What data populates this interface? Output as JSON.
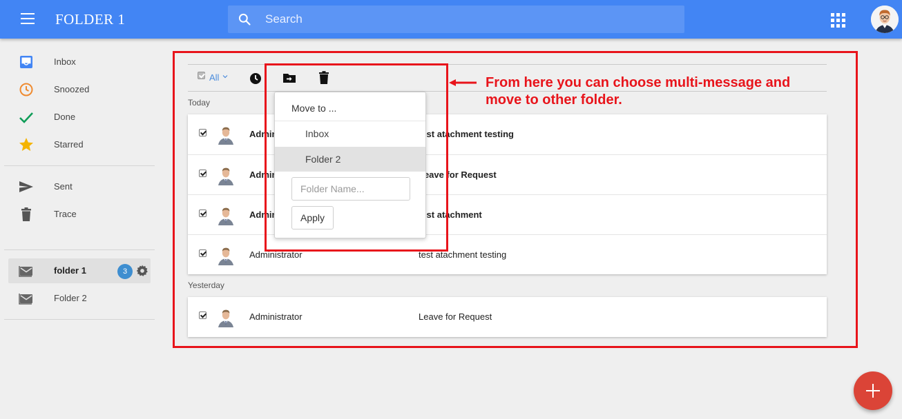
{
  "header": {
    "title": "FOLDER 1",
    "search_placeholder": "Search",
    "menu_icon": "menu-icon",
    "apps_icon": "apps-grid-icon"
  },
  "sidebar": {
    "items": [
      {
        "label": "Inbox",
        "icon": "inbox-icon",
        "color": "#4285f4"
      },
      {
        "label": "Snoozed",
        "icon": "clock-icon",
        "color": "#ef8a2f"
      },
      {
        "label": "Done",
        "icon": "check-icon",
        "color": "#0f9d58"
      },
      {
        "label": "Starred",
        "icon": "star-icon",
        "color": "#f4b400"
      },
      {
        "label": "Sent",
        "icon": "send-icon",
        "color": "#555555"
      },
      {
        "label": "Trace",
        "icon": "trash-icon",
        "color": "#555555"
      }
    ],
    "folders": [
      {
        "label": "folder 1",
        "badge": "3",
        "active": true,
        "icon": "folder-mail-icon"
      },
      {
        "label": "Folder 2",
        "active": false,
        "icon": "folder-mail-icon"
      }
    ]
  },
  "toolbar": {
    "select_all_label": "All"
  },
  "move_menu": {
    "title": "Move to ...",
    "options": [
      "Inbox",
      "Folder 2"
    ],
    "highlighted": "Folder 2",
    "folder_name_placeholder": "Folder Name...",
    "apply_label": "Apply"
  },
  "annotation": {
    "text": "From here you can choose multi-message and move to other folder.",
    "color": "#e8141b"
  },
  "groups": [
    {
      "label": "Today",
      "messages": [
        {
          "sender": "Administrator",
          "subject": "test atachment testing",
          "unread": true,
          "checked": true
        },
        {
          "sender": "Administrator",
          "subject": "Leave for Request",
          "unread": true,
          "checked": true
        },
        {
          "sender": "Administrator",
          "subject": "test atachment",
          "unread": true,
          "checked": true
        },
        {
          "sender": "Administrator",
          "subject": "test atachment testing",
          "unread": false,
          "checked": true
        }
      ]
    },
    {
      "label": "Yesterday",
      "messages": [
        {
          "sender": "Administrator",
          "subject": "Leave for Request",
          "unread": false,
          "checked": true
        }
      ]
    }
  ],
  "fab": {
    "icon": "plus-icon",
    "color": "#db4437"
  }
}
